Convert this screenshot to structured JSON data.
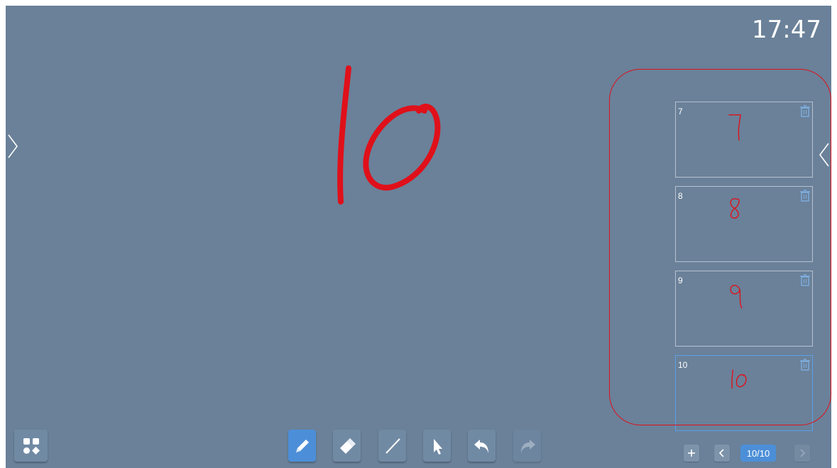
{
  "status": {
    "clock": "17:47"
  },
  "pages_panel": {
    "thumbnails": [
      {
        "number": "7",
        "content": "7",
        "active": false
      },
      {
        "number": "8",
        "content": "8",
        "active": false
      },
      {
        "number": "9",
        "content": "9",
        "active": false
      },
      {
        "number": "10",
        "content": "10",
        "active": true
      }
    ]
  },
  "canvas": {
    "handwritten_text": "10",
    "ink_color": "#e0101a"
  },
  "toolbar": {
    "tools": [
      {
        "name": "pen-tool",
        "icon": "pencil-icon",
        "active": true
      },
      {
        "name": "eraser-tool",
        "icon": "eraser-icon",
        "active": false
      },
      {
        "name": "line-tool",
        "icon": "line-icon",
        "active": false
      },
      {
        "name": "select-tool",
        "icon": "cursor-arrow-icon",
        "active": false
      },
      {
        "name": "undo-button",
        "icon": "undo-icon",
        "active": false
      },
      {
        "name": "redo-button",
        "icon": "redo-icon",
        "active": false,
        "disabled": true
      }
    ]
  },
  "pagination": {
    "indicator": "10/10"
  },
  "colors": {
    "background": "#6a8199",
    "accent": "#4c8fd8",
    "highlight_ring": "#e0101a"
  }
}
